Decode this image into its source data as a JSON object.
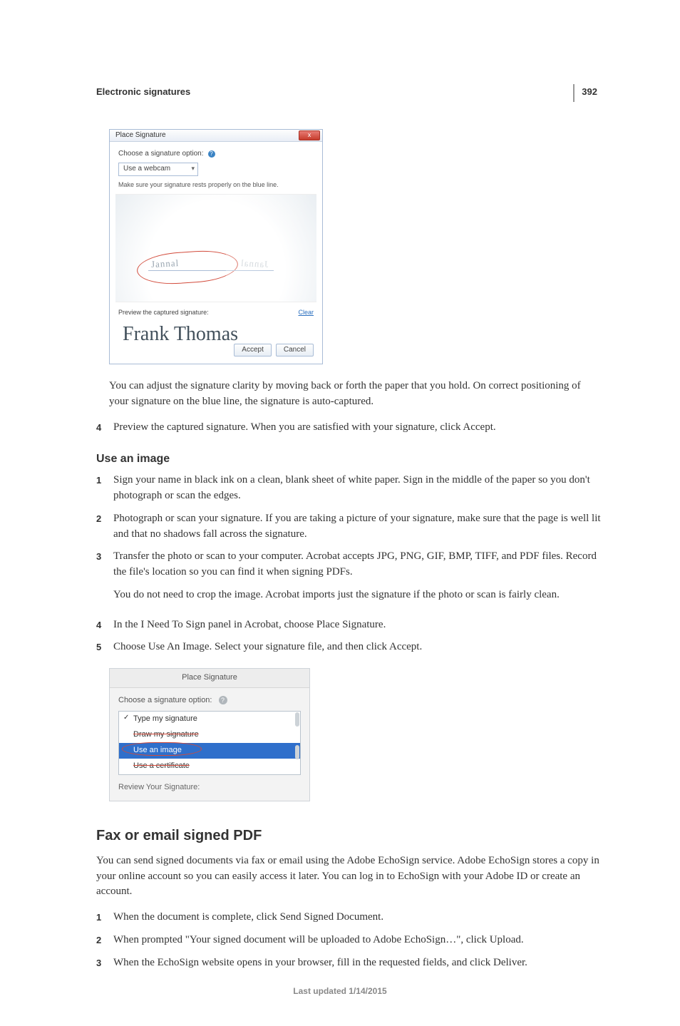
{
  "page": {
    "number": "392",
    "running_head": "Electronic signatures",
    "footer": "Last updated 1/14/2015"
  },
  "fig1": {
    "title": "Place Signature",
    "close": "x",
    "choose_label": "Choose a signature option:",
    "select_value": "Use a webcam",
    "instruction": "Make sure your signature rests properly on the blue line.",
    "handwriting": "Jannal",
    "preview_label": "Preview the captured signature:",
    "clear": "Clear",
    "signature_script": "Frank Thomas",
    "accept": "Accept",
    "cancel": "Cancel"
  },
  "body": {
    "after_fig1_p1": "You can adjust the signature clarity by moving back or forth the paper that you hold. On correct positioning of your signature on the blue line, the signature is auto-captured.",
    "webcam_step4": "Preview the captured signature. When you are satisfied with your signature, click Accept.",
    "use_image_heading": "Use an image",
    "img_step1": "Sign your name in black ink on a clean, blank sheet of white paper. Sign in the middle of the paper so you don't photograph or scan the edges.",
    "img_step2": "Photograph or scan your signature. If you are taking a picture of your signature, make sure that the page is well lit and that no shadows fall across the signature.",
    "img_step3_p1": "Transfer the photo or scan to your computer. Acrobat accepts JPG, PNG, GIF, BMP, TIFF, and PDF files. Record the file's location so you can find it when signing PDFs.",
    "img_step3_p2": "You do not need to crop the image. Acrobat imports just the signature if the photo or scan is fairly clean.",
    "img_step4": "In the I Need To Sign panel in Acrobat, choose Place Signature.",
    "img_step5": "Choose Use An Image. Select your signature file, and then click Accept."
  },
  "fig2": {
    "title": "Place Signature",
    "choose_label": "Choose a signature option:",
    "opt_type": "Type my signature",
    "opt_draw": "Draw my signature",
    "opt_image": "Use an image",
    "opt_cert": "Use a certificate",
    "review": "Review Your Signature:"
  },
  "fax": {
    "heading": "Fax or email signed PDF",
    "intro": "You can send signed documents via fax or email using the Adobe EchoSign service. Adobe EchoSign stores a copy in your online account so you can easily access it later. You can log in to EchoSign with your Adobe ID or create an account.",
    "step1": "When the document is complete, click Send Signed Document.",
    "step2": "When prompted \"Your signed document will be uploaded to Adobe EchoSign…\", click Upload.",
    "step3": "When the EchoSign website opens in your browser, fill in the requested fields, and click Deliver."
  },
  "nums": {
    "n1": "1",
    "n2": "2",
    "n3": "3",
    "n4": "4",
    "n5": "5"
  }
}
